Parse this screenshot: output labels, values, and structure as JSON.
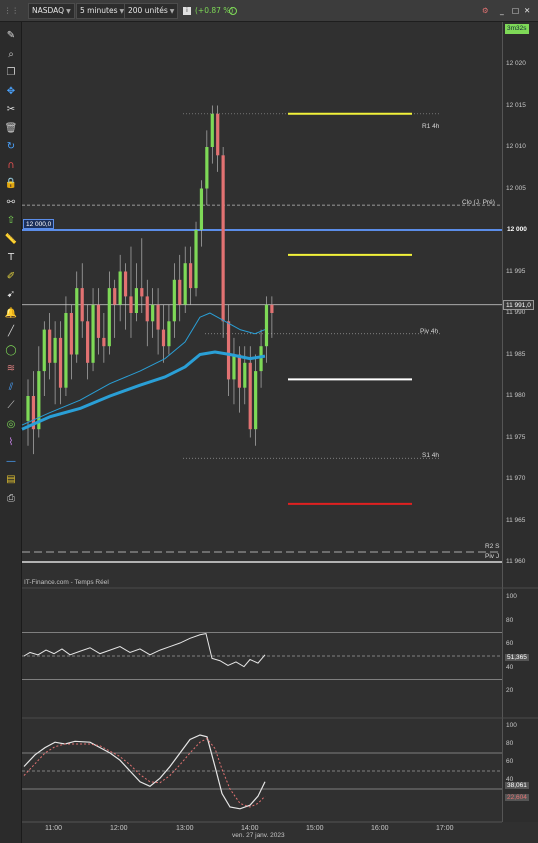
{
  "topbar": {
    "symbol": "NASDAQ",
    "timeframe": "5 minutes",
    "units": "200 unités",
    "change": "(+0.87 %)"
  },
  "timer": "3m32s",
  "price_axis": [
    "12 020",
    "12 015",
    "12 010",
    "12 005",
    "12 000",
    "11 995",
    "11 990",
    "11 985",
    "11 980",
    "11 975",
    "11 970",
    "11 965",
    "11 960"
  ],
  "current_price": "11 991,0",
  "level_12000": "12 000,0",
  "levels": {
    "r1": "R1 4h",
    "clo": "Clo (J. Pré)",
    "piv": "Piv 4h",
    "s1": "S1 4h",
    "r2": "R2 S",
    "pivj": "Piv J"
  },
  "pane1": {
    "title": "IT-Finance.com - Temps Réel",
    "ticks": [
      "100",
      "80",
      "60",
      "40",
      "20"
    ],
    "value": "51,365"
  },
  "pane2": {
    "ticks": [
      "100",
      "80",
      "60",
      "40",
      "20"
    ],
    "value_k": "38,061",
    "value_d": "22,604"
  },
  "time_axis": [
    "11:00",
    "12:00",
    "13:00",
    "14:00",
    "15:00",
    "16:00",
    "17:00"
  ],
  "date_label": "ven. 27 janv. 2023",
  "colors": {
    "bg": "#303030",
    "up": "#7ed957",
    "down": "#e27272",
    "ma": "#2a9fd6",
    "level_blue": "#5b8de8",
    "yellow": "#f2f23a",
    "red": "#e02020"
  },
  "toolbar_icons": [
    "pencil-icon",
    "magnifier-icon",
    "copy-icon",
    "crosshair-icon",
    "eraser-icon",
    "trash-icon",
    "rotate-icon",
    "magnet-icon",
    "lock-icon",
    "link-icon",
    "arrow-up-icon",
    "ruler-icon",
    "text-icon",
    "marker-icon",
    "cursor-icon",
    "bell-icon",
    "line-icon",
    "ellipse-icon",
    "fibonacci-icon",
    "channel-icon",
    "trend-icon",
    "target-icon",
    "pattern-icon",
    "minus-icon",
    "document-icon",
    "print-icon"
  ]
}
